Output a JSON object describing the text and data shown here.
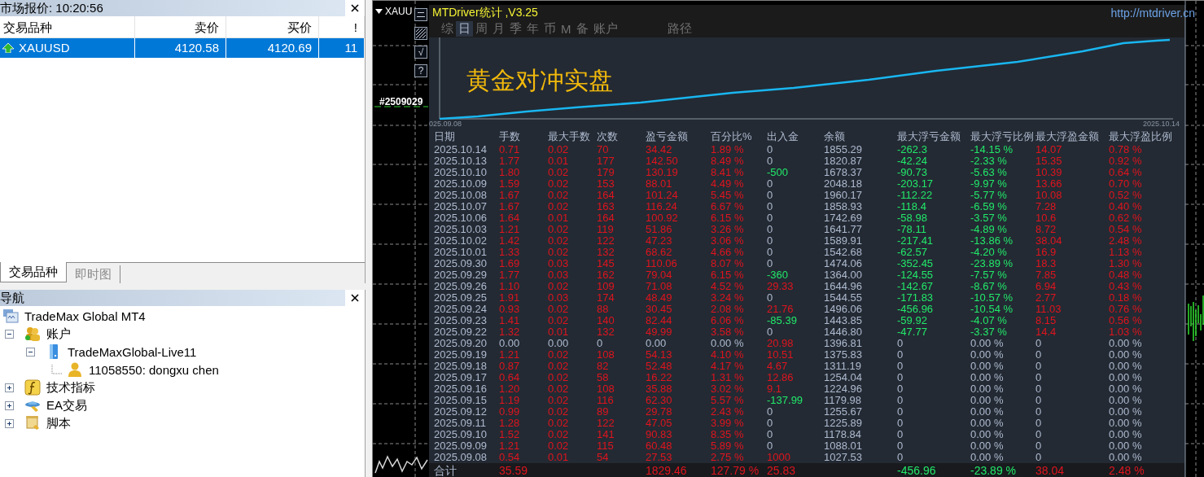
{
  "market_watch": {
    "title": "市场报价: 10:20:56",
    "columns": [
      "交易品种",
      "卖价",
      "买价",
      "!"
    ],
    "rows": [
      {
        "symbol": "XAUUSD",
        "bid": "4120.58",
        "ask": "4120.69",
        "spread": "11",
        "selected": true
      }
    ],
    "tabs": [
      {
        "label": "交易品种",
        "selected": true
      },
      {
        "label": "即时图",
        "selected": false
      }
    ]
  },
  "navigator": {
    "title": "导航",
    "tree": [
      {
        "label": "TradeMax Global MT4",
        "kind": "terminal",
        "children": [
          {
            "label": "账户",
            "kind": "accounts",
            "expanded": true,
            "children": [
              {
                "label": "TradeMaxGlobal-Live11",
                "kind": "server",
                "expanded": true,
                "children": [
                  {
                    "label": "11058550: dongxu chen",
                    "kind": "user"
                  }
                ]
              }
            ]
          },
          {
            "label": "技术指标",
            "kind": "indicators",
            "expanded": false
          },
          {
            "label": "EA交易",
            "kind": "experts",
            "expanded": false
          },
          {
            "label": "脚本",
            "kind": "scripts",
            "expanded": false
          }
        ]
      }
    ]
  },
  "chart": {
    "symbol": "XAUU",
    "order_label": "#2509029",
    "tool_buttons": [
      {
        "kind": "lines"
      },
      {
        "kind": "hatch"
      },
      {
        "kind": "text",
        "label": "√"
      },
      {
        "kind": "text",
        "label": "?"
      }
    ]
  },
  "stats_panel": {
    "title": "MTDriver统计 ,V3.25",
    "url": "http://mtdriver.cn",
    "tabs": [
      {
        "label": "综",
        "selected": false
      },
      {
        "label": "日",
        "selected": true
      },
      {
        "label": "周",
        "selected": false
      },
      {
        "label": "月",
        "selected": false
      },
      {
        "label": "季",
        "selected": false
      },
      {
        "label": "年",
        "selected": false
      },
      {
        "label": "币",
        "selected": false
      },
      {
        "label": "M",
        "selected": false
      },
      {
        "label": "备",
        "selected": false
      },
      {
        "label": "账户",
        "selected": false
      }
    ],
    "path_tab": {
      "label": "路径",
      "selected": false
    },
    "equity_title": "黄金对冲实盘",
    "start_date": "025.09.08",
    "end_date": "2025.10.14",
    "columns": [
      "日期",
      "手数",
      "最大手数",
      "次数",
      "盈亏金额",
      "百分比%",
      "出入金",
      "余额",
      "最大浮亏金额",
      "最大浮亏比例",
      "最大浮盈金额",
      "最大浮盈比例"
    ],
    "rows": [
      {
        "cells": [
          {
            "text": "2025.10.14",
            "color": "#aebad0"
          },
          {
            "text": "0.71",
            "color": "#e0141e"
          },
          {
            "text": "0.02",
            "color": "#e0141e"
          },
          {
            "text": "70",
            "color": "#e0141e"
          },
          {
            "text": "34.42",
            "color": "#e0141e"
          },
          {
            "text": "1.89 %",
            "color": "#e0141e"
          },
          {
            "text": "0",
            "color": "#aebad0"
          },
          {
            "text": "1855.29",
            "color": "#aebad0"
          },
          {
            "text": "-262.3",
            "color": "#22e86a"
          },
          {
            "text": "-14.15 %",
            "color": "#22e86a"
          },
          {
            "text": "14.07",
            "color": "#e0141e"
          },
          {
            "text": "0.78 %",
            "color": "#e0141e"
          }
        ]
      },
      {
        "cells": [
          {
            "text": "2025.10.13",
            "color": "#aebad0"
          },
          {
            "text": "1.77",
            "color": "#e0141e"
          },
          {
            "text": "0.01",
            "color": "#e0141e"
          },
          {
            "text": "177",
            "color": "#e0141e"
          },
          {
            "text": "142.50",
            "color": "#e0141e"
          },
          {
            "text": "8.49 %",
            "color": "#e0141e"
          },
          {
            "text": "0",
            "color": "#aebad0"
          },
          {
            "text": "1820.87",
            "color": "#aebad0"
          },
          {
            "text": "-42.24",
            "color": "#22e86a"
          },
          {
            "text": "-2.33 %",
            "color": "#22e86a"
          },
          {
            "text": "15.35",
            "color": "#e0141e"
          },
          {
            "text": "0.92 %",
            "color": "#e0141e"
          }
        ]
      },
      {
        "cells": [
          {
            "text": "2025.10.10",
            "color": "#aebad0"
          },
          {
            "text": "1.80",
            "color": "#e0141e"
          },
          {
            "text": "0.02",
            "color": "#e0141e"
          },
          {
            "text": "179",
            "color": "#e0141e"
          },
          {
            "text": "130.19",
            "color": "#e0141e"
          },
          {
            "text": "8.41 %",
            "color": "#e0141e"
          },
          {
            "text": "-500",
            "color": "#22e86a"
          },
          {
            "text": "1678.37",
            "color": "#aebad0"
          },
          {
            "text": "-90.73",
            "color": "#22e86a"
          },
          {
            "text": "-5.63 %",
            "color": "#22e86a"
          },
          {
            "text": "10.39",
            "color": "#e0141e"
          },
          {
            "text": "0.64 %",
            "color": "#e0141e"
          }
        ]
      },
      {
        "cells": [
          {
            "text": "2025.10.09",
            "color": "#aebad0"
          },
          {
            "text": "1.59",
            "color": "#e0141e"
          },
          {
            "text": "0.02",
            "color": "#e0141e"
          },
          {
            "text": "153",
            "color": "#e0141e"
          },
          {
            "text": "88.01",
            "color": "#e0141e"
          },
          {
            "text": "4.49 %",
            "color": "#e0141e"
          },
          {
            "text": "0",
            "color": "#aebad0"
          },
          {
            "text": "2048.18",
            "color": "#aebad0"
          },
          {
            "text": "-203.17",
            "color": "#22e86a"
          },
          {
            "text": "-9.97 %",
            "color": "#22e86a"
          },
          {
            "text": "13.66",
            "color": "#e0141e"
          },
          {
            "text": "0.70 %",
            "color": "#e0141e"
          }
        ]
      },
      {
        "cells": [
          {
            "text": "2025.10.08",
            "color": "#aebad0"
          },
          {
            "text": "1.67",
            "color": "#e0141e"
          },
          {
            "text": "0.02",
            "color": "#e0141e"
          },
          {
            "text": "164",
            "color": "#e0141e"
          },
          {
            "text": "101.24",
            "color": "#e0141e"
          },
          {
            "text": "5.45 %",
            "color": "#e0141e"
          },
          {
            "text": "0",
            "color": "#aebad0"
          },
          {
            "text": "1960.17",
            "color": "#aebad0"
          },
          {
            "text": "-112.22",
            "color": "#22e86a"
          },
          {
            "text": "-5.77 %",
            "color": "#22e86a"
          },
          {
            "text": "10.08",
            "color": "#e0141e"
          },
          {
            "text": "0.52 %",
            "color": "#e0141e"
          }
        ]
      },
      {
        "cells": [
          {
            "text": "2025.10.07",
            "color": "#aebad0"
          },
          {
            "text": "1.67",
            "color": "#e0141e"
          },
          {
            "text": "0.02",
            "color": "#e0141e"
          },
          {
            "text": "163",
            "color": "#e0141e"
          },
          {
            "text": "116.24",
            "color": "#e0141e"
          },
          {
            "text": "6.67 %",
            "color": "#e0141e"
          },
          {
            "text": "0",
            "color": "#aebad0"
          },
          {
            "text": "1858.93",
            "color": "#aebad0"
          },
          {
            "text": "-118.4",
            "color": "#22e86a"
          },
          {
            "text": "-6.59 %",
            "color": "#22e86a"
          },
          {
            "text": "7.28",
            "color": "#e0141e"
          },
          {
            "text": "0.40 %",
            "color": "#e0141e"
          }
        ]
      },
      {
        "cells": [
          {
            "text": "2025.10.06",
            "color": "#aebad0"
          },
          {
            "text": "1.64",
            "color": "#e0141e"
          },
          {
            "text": "0.01",
            "color": "#e0141e"
          },
          {
            "text": "164",
            "color": "#e0141e"
          },
          {
            "text": "100.92",
            "color": "#e0141e"
          },
          {
            "text": "6.15 %",
            "color": "#e0141e"
          },
          {
            "text": "0",
            "color": "#aebad0"
          },
          {
            "text": "1742.69",
            "color": "#aebad0"
          },
          {
            "text": "-58.98",
            "color": "#22e86a"
          },
          {
            "text": "-3.57 %",
            "color": "#22e86a"
          },
          {
            "text": "10.6",
            "color": "#e0141e"
          },
          {
            "text": "0.62 %",
            "color": "#e0141e"
          }
        ]
      },
      {
        "cells": [
          {
            "text": "2025.10.03",
            "color": "#aebad0"
          },
          {
            "text": "1.21",
            "color": "#e0141e"
          },
          {
            "text": "0.02",
            "color": "#e0141e"
          },
          {
            "text": "119",
            "color": "#e0141e"
          },
          {
            "text": "51.86",
            "color": "#e0141e"
          },
          {
            "text": "3.26 %",
            "color": "#e0141e"
          },
          {
            "text": "0",
            "color": "#aebad0"
          },
          {
            "text": "1641.77",
            "color": "#aebad0"
          },
          {
            "text": "-78.11",
            "color": "#22e86a"
          },
          {
            "text": "-4.89 %",
            "color": "#22e86a"
          },
          {
            "text": "8.72",
            "color": "#e0141e"
          },
          {
            "text": "0.54 %",
            "color": "#e0141e"
          }
        ]
      },
      {
        "cells": [
          {
            "text": "2025.10.02",
            "color": "#aebad0"
          },
          {
            "text": "1.42",
            "color": "#e0141e"
          },
          {
            "text": "0.02",
            "color": "#e0141e"
          },
          {
            "text": "122",
            "color": "#e0141e"
          },
          {
            "text": "47.23",
            "color": "#e0141e"
          },
          {
            "text": "3.06 %",
            "color": "#e0141e"
          },
          {
            "text": "0",
            "color": "#aebad0"
          },
          {
            "text": "1589.91",
            "color": "#aebad0"
          },
          {
            "text": "-217.41",
            "color": "#22e86a"
          },
          {
            "text": "-13.86 %",
            "color": "#22e86a"
          },
          {
            "text": "38.04",
            "color": "#e0141e"
          },
          {
            "text": "2.48 %",
            "color": "#e0141e"
          }
        ]
      },
      {
        "cells": [
          {
            "text": "2025.10.01",
            "color": "#aebad0"
          },
          {
            "text": "1.33",
            "color": "#e0141e"
          },
          {
            "text": "0.02",
            "color": "#e0141e"
          },
          {
            "text": "132",
            "color": "#e0141e"
          },
          {
            "text": "68.62",
            "color": "#e0141e"
          },
          {
            "text": "4.66 %",
            "color": "#e0141e"
          },
          {
            "text": "0",
            "color": "#aebad0"
          },
          {
            "text": "1542.68",
            "color": "#aebad0"
          },
          {
            "text": "-62.57",
            "color": "#22e86a"
          },
          {
            "text": "-4.20 %",
            "color": "#22e86a"
          },
          {
            "text": "16.9",
            "color": "#e0141e"
          },
          {
            "text": "1.13 %",
            "color": "#e0141e"
          }
        ]
      },
      {
        "cells": [
          {
            "text": "2025.09.30",
            "color": "#aebad0"
          },
          {
            "text": "1.69",
            "color": "#e0141e"
          },
          {
            "text": "0.03",
            "color": "#e0141e"
          },
          {
            "text": "145",
            "color": "#e0141e"
          },
          {
            "text": "110.06",
            "color": "#e0141e"
          },
          {
            "text": "8.07 %",
            "color": "#e0141e"
          },
          {
            "text": "0",
            "color": "#aebad0"
          },
          {
            "text": "1474.06",
            "color": "#aebad0"
          },
          {
            "text": "-352.45",
            "color": "#22e86a"
          },
          {
            "text": "-23.89 %",
            "color": "#22e86a"
          },
          {
            "text": "18.3",
            "color": "#e0141e"
          },
          {
            "text": "1.30 %",
            "color": "#e0141e"
          }
        ]
      },
      {
        "cells": [
          {
            "text": "2025.09.29",
            "color": "#aebad0"
          },
          {
            "text": "1.77",
            "color": "#e0141e"
          },
          {
            "text": "0.03",
            "color": "#e0141e"
          },
          {
            "text": "162",
            "color": "#e0141e"
          },
          {
            "text": "79.04",
            "color": "#e0141e"
          },
          {
            "text": "6.15 %",
            "color": "#e0141e"
          },
          {
            "text": "-360",
            "color": "#22e86a"
          },
          {
            "text": "1364.00",
            "color": "#aebad0"
          },
          {
            "text": "-124.55",
            "color": "#22e86a"
          },
          {
            "text": "-7.57 %",
            "color": "#22e86a"
          },
          {
            "text": "7.85",
            "color": "#e0141e"
          },
          {
            "text": "0.48 %",
            "color": "#e0141e"
          }
        ]
      },
      {
        "cells": [
          {
            "text": "2025.09.26",
            "color": "#aebad0"
          },
          {
            "text": "1.10",
            "color": "#e0141e"
          },
          {
            "text": "0.02",
            "color": "#e0141e"
          },
          {
            "text": "109",
            "color": "#e0141e"
          },
          {
            "text": "71.08",
            "color": "#e0141e"
          },
          {
            "text": "4.52 %",
            "color": "#e0141e"
          },
          {
            "text": "29.33",
            "color": "#e0141e"
          },
          {
            "text": "1644.96",
            "color": "#aebad0"
          },
          {
            "text": "-142.67",
            "color": "#22e86a"
          },
          {
            "text": "-8.67 %",
            "color": "#22e86a"
          },
          {
            "text": "6.94",
            "color": "#e0141e"
          },
          {
            "text": "0.43 %",
            "color": "#e0141e"
          }
        ]
      },
      {
        "cells": [
          {
            "text": "2025.09.25",
            "color": "#aebad0"
          },
          {
            "text": "1.91",
            "color": "#e0141e"
          },
          {
            "text": "0.03",
            "color": "#e0141e"
          },
          {
            "text": "174",
            "color": "#e0141e"
          },
          {
            "text": "48.49",
            "color": "#e0141e"
          },
          {
            "text": "3.24 %",
            "color": "#e0141e"
          },
          {
            "text": "0",
            "color": "#aebad0"
          },
          {
            "text": "1544.55",
            "color": "#aebad0"
          },
          {
            "text": "-171.83",
            "color": "#22e86a"
          },
          {
            "text": "-10.57 %",
            "color": "#22e86a"
          },
          {
            "text": "2.77",
            "color": "#e0141e"
          },
          {
            "text": "0.18 %",
            "color": "#e0141e"
          }
        ]
      },
      {
        "cells": [
          {
            "text": "2025.09.24",
            "color": "#aebad0"
          },
          {
            "text": "0.93",
            "color": "#e0141e"
          },
          {
            "text": "0.02",
            "color": "#e0141e"
          },
          {
            "text": "88",
            "color": "#e0141e"
          },
          {
            "text": "30.45",
            "color": "#e0141e"
          },
          {
            "text": "2.08 %",
            "color": "#e0141e"
          },
          {
            "text": "21.76",
            "color": "#e0141e"
          },
          {
            "text": "1496.06",
            "color": "#aebad0"
          },
          {
            "text": "-456.96",
            "color": "#22e86a"
          },
          {
            "text": "-10.54 %",
            "color": "#22e86a"
          },
          {
            "text": "11.03",
            "color": "#e0141e"
          },
          {
            "text": "0.76 %",
            "color": "#e0141e"
          }
        ]
      },
      {
        "cells": [
          {
            "text": "2025.09.23",
            "color": "#aebad0"
          },
          {
            "text": "1.41",
            "color": "#e0141e"
          },
          {
            "text": "0.02",
            "color": "#e0141e"
          },
          {
            "text": "140",
            "color": "#e0141e"
          },
          {
            "text": "82.44",
            "color": "#e0141e"
          },
          {
            "text": "6.06 %",
            "color": "#e0141e"
          },
          {
            "text": "-85.39",
            "color": "#22e86a"
          },
          {
            "text": "1443.85",
            "color": "#aebad0"
          },
          {
            "text": "-59.92",
            "color": "#22e86a"
          },
          {
            "text": "-4.07 %",
            "color": "#22e86a"
          },
          {
            "text": "8.15",
            "color": "#e0141e"
          },
          {
            "text": "0.56 %",
            "color": "#e0141e"
          }
        ]
      },
      {
        "cells": [
          {
            "text": "2025.09.22",
            "color": "#aebad0"
          },
          {
            "text": "1.32",
            "color": "#e0141e"
          },
          {
            "text": "0.01",
            "color": "#e0141e"
          },
          {
            "text": "132",
            "color": "#e0141e"
          },
          {
            "text": "49.99",
            "color": "#e0141e"
          },
          {
            "text": "3.58 %",
            "color": "#e0141e"
          },
          {
            "text": "0",
            "color": "#aebad0"
          },
          {
            "text": "1446.80",
            "color": "#aebad0"
          },
          {
            "text": "-47.77",
            "color": "#22e86a"
          },
          {
            "text": "-3.37 %",
            "color": "#22e86a"
          },
          {
            "text": "14.4",
            "color": "#e0141e"
          },
          {
            "text": "1.03 %",
            "color": "#e0141e"
          }
        ]
      },
      {
        "cells": [
          {
            "text": "2025.09.20",
            "color": "#aebad0"
          },
          {
            "text": "0.00",
            "color": "#aebad0"
          },
          {
            "text": "0.00",
            "color": "#aebad0"
          },
          {
            "text": "0",
            "color": "#aebad0"
          },
          {
            "text": "0.00",
            "color": "#aebad0"
          },
          {
            "text": "0.00 %",
            "color": "#aebad0"
          },
          {
            "text": "20.98",
            "color": "#e0141e"
          },
          {
            "text": "1396.81",
            "color": "#aebad0"
          },
          {
            "text": "0",
            "color": "#aebad0"
          },
          {
            "text": "0.00 %",
            "color": "#aebad0"
          },
          {
            "text": "0",
            "color": "#aebad0"
          },
          {
            "text": "0.00 %",
            "color": "#aebad0"
          }
        ]
      },
      {
        "cells": [
          {
            "text": "2025.09.19",
            "color": "#aebad0"
          },
          {
            "text": "1.21",
            "color": "#e0141e"
          },
          {
            "text": "0.02",
            "color": "#e0141e"
          },
          {
            "text": "108",
            "color": "#e0141e"
          },
          {
            "text": "54.13",
            "color": "#e0141e"
          },
          {
            "text": "4.10 %",
            "color": "#e0141e"
          },
          {
            "text": "10.51",
            "color": "#e0141e"
          },
          {
            "text": "1375.83",
            "color": "#aebad0"
          },
          {
            "text": "0",
            "color": "#aebad0"
          },
          {
            "text": "0.00 %",
            "color": "#aebad0"
          },
          {
            "text": "0",
            "color": "#aebad0"
          },
          {
            "text": "0.00 %",
            "color": "#aebad0"
          }
        ]
      },
      {
        "cells": [
          {
            "text": "2025.09.18",
            "color": "#aebad0"
          },
          {
            "text": "0.87",
            "color": "#e0141e"
          },
          {
            "text": "0.02",
            "color": "#e0141e"
          },
          {
            "text": "82",
            "color": "#e0141e"
          },
          {
            "text": "52.48",
            "color": "#e0141e"
          },
          {
            "text": "4.17 %",
            "color": "#e0141e"
          },
          {
            "text": "4.67",
            "color": "#e0141e"
          },
          {
            "text": "1311.19",
            "color": "#aebad0"
          },
          {
            "text": "0",
            "color": "#aebad0"
          },
          {
            "text": "0.00 %",
            "color": "#aebad0"
          },
          {
            "text": "0",
            "color": "#aebad0"
          },
          {
            "text": "0.00 %",
            "color": "#aebad0"
          }
        ]
      },
      {
        "cells": [
          {
            "text": "2025.09.17",
            "color": "#aebad0"
          },
          {
            "text": "0.64",
            "color": "#e0141e"
          },
          {
            "text": "0.02",
            "color": "#e0141e"
          },
          {
            "text": "58",
            "color": "#e0141e"
          },
          {
            "text": "16.22",
            "color": "#e0141e"
          },
          {
            "text": "1.31 %",
            "color": "#e0141e"
          },
          {
            "text": "12.86",
            "color": "#e0141e"
          },
          {
            "text": "1254.04",
            "color": "#aebad0"
          },
          {
            "text": "0",
            "color": "#aebad0"
          },
          {
            "text": "0.00 %",
            "color": "#aebad0"
          },
          {
            "text": "0",
            "color": "#aebad0"
          },
          {
            "text": "0.00 %",
            "color": "#aebad0"
          }
        ]
      },
      {
        "cells": [
          {
            "text": "2025.09.16",
            "color": "#aebad0"
          },
          {
            "text": "1.20",
            "color": "#e0141e"
          },
          {
            "text": "0.02",
            "color": "#e0141e"
          },
          {
            "text": "108",
            "color": "#e0141e"
          },
          {
            "text": "35.88",
            "color": "#e0141e"
          },
          {
            "text": "3.02 %",
            "color": "#e0141e"
          },
          {
            "text": "9.1",
            "color": "#e0141e"
          },
          {
            "text": "1224.96",
            "color": "#aebad0"
          },
          {
            "text": "0",
            "color": "#aebad0"
          },
          {
            "text": "0.00 %",
            "color": "#aebad0"
          },
          {
            "text": "0",
            "color": "#aebad0"
          },
          {
            "text": "0.00 %",
            "color": "#aebad0"
          }
        ]
      },
      {
        "cells": [
          {
            "text": "2025.09.15",
            "color": "#aebad0"
          },
          {
            "text": "1.19",
            "color": "#e0141e"
          },
          {
            "text": "0.02",
            "color": "#e0141e"
          },
          {
            "text": "116",
            "color": "#e0141e"
          },
          {
            "text": "62.30",
            "color": "#e0141e"
          },
          {
            "text": "5.57 %",
            "color": "#e0141e"
          },
          {
            "text": "-137.99",
            "color": "#22e86a"
          },
          {
            "text": "1179.98",
            "color": "#aebad0"
          },
          {
            "text": "0",
            "color": "#aebad0"
          },
          {
            "text": "0.00 %",
            "color": "#aebad0"
          },
          {
            "text": "0",
            "color": "#aebad0"
          },
          {
            "text": "0.00 %",
            "color": "#aebad0"
          }
        ]
      },
      {
        "cells": [
          {
            "text": "2025.09.12",
            "color": "#aebad0"
          },
          {
            "text": "0.99",
            "color": "#e0141e"
          },
          {
            "text": "0.02",
            "color": "#e0141e"
          },
          {
            "text": "89",
            "color": "#e0141e"
          },
          {
            "text": "29.78",
            "color": "#e0141e"
          },
          {
            "text": "2.43 %",
            "color": "#e0141e"
          },
          {
            "text": "0",
            "color": "#aebad0"
          },
          {
            "text": "1255.67",
            "color": "#aebad0"
          },
          {
            "text": "0",
            "color": "#aebad0"
          },
          {
            "text": "0.00 %",
            "color": "#aebad0"
          },
          {
            "text": "0",
            "color": "#aebad0"
          },
          {
            "text": "0.00 %",
            "color": "#aebad0"
          }
        ]
      },
      {
        "cells": [
          {
            "text": "2025.09.11",
            "color": "#aebad0"
          },
          {
            "text": "1.28",
            "color": "#e0141e"
          },
          {
            "text": "0.02",
            "color": "#e0141e"
          },
          {
            "text": "122",
            "color": "#e0141e"
          },
          {
            "text": "47.05",
            "color": "#e0141e"
          },
          {
            "text": "3.99 %",
            "color": "#e0141e"
          },
          {
            "text": "0",
            "color": "#aebad0"
          },
          {
            "text": "1225.89",
            "color": "#aebad0"
          },
          {
            "text": "0",
            "color": "#aebad0"
          },
          {
            "text": "0.00 %",
            "color": "#aebad0"
          },
          {
            "text": "0",
            "color": "#aebad0"
          },
          {
            "text": "0.00 %",
            "color": "#aebad0"
          }
        ]
      },
      {
        "cells": [
          {
            "text": "2025.09.10",
            "color": "#aebad0"
          },
          {
            "text": "1.52",
            "color": "#e0141e"
          },
          {
            "text": "0.02",
            "color": "#e0141e"
          },
          {
            "text": "141",
            "color": "#e0141e"
          },
          {
            "text": "90.83",
            "color": "#e0141e"
          },
          {
            "text": "8.35 %",
            "color": "#e0141e"
          },
          {
            "text": "0",
            "color": "#aebad0"
          },
          {
            "text": "1178.84",
            "color": "#aebad0"
          },
          {
            "text": "0",
            "color": "#aebad0"
          },
          {
            "text": "0.00 %",
            "color": "#aebad0"
          },
          {
            "text": "0",
            "color": "#aebad0"
          },
          {
            "text": "0.00 %",
            "color": "#aebad0"
          }
        ]
      },
      {
        "cells": [
          {
            "text": "2025.09.09",
            "color": "#aebad0"
          },
          {
            "text": "1.21",
            "color": "#e0141e"
          },
          {
            "text": "0.02",
            "color": "#e0141e"
          },
          {
            "text": "115",
            "color": "#e0141e"
          },
          {
            "text": "60.48",
            "color": "#e0141e"
          },
          {
            "text": "5.89 %",
            "color": "#e0141e"
          },
          {
            "text": "0",
            "color": "#aebad0"
          },
          {
            "text": "1088.01",
            "color": "#aebad0"
          },
          {
            "text": "0",
            "color": "#aebad0"
          },
          {
            "text": "0.00 %",
            "color": "#aebad0"
          },
          {
            "text": "0",
            "color": "#aebad0"
          },
          {
            "text": "0.00 %",
            "color": "#aebad0"
          }
        ]
      },
      {
        "cells": [
          {
            "text": "2025.09.08",
            "color": "#aebad0"
          },
          {
            "text": "0.54",
            "color": "#e0141e"
          },
          {
            "text": "0.01",
            "color": "#e0141e"
          },
          {
            "text": "54",
            "color": "#e0141e"
          },
          {
            "text": "27.53",
            "color": "#e0141e"
          },
          {
            "text": "2.75 %",
            "color": "#e0141e"
          },
          {
            "text": "1000",
            "color": "#e0141e"
          },
          {
            "text": "1027.53",
            "color": "#aebad0"
          },
          {
            "text": "0",
            "color": "#aebad0"
          },
          {
            "text": "0.00 %",
            "color": "#aebad0"
          },
          {
            "text": "0",
            "color": "#aebad0"
          },
          {
            "text": "0.00 %",
            "color": "#aebad0"
          }
        ]
      }
    ],
    "totals": {
      "cells": [
        {
          "text": "合计",
          "color": "#aebad0"
        },
        {
          "text": "35.59",
          "color": "#e0141e"
        },
        {
          "text": ""
        },
        {
          "text": ""
        },
        {
          "text": "1829.46",
          "color": "#e0141e"
        },
        {
          "text": "127.79 %",
          "color": "#e0141e"
        },
        {
          "text": "25.83",
          "color": "#e0141e"
        },
        {
          "text": ""
        },
        {
          "text": "-456.96",
          "color": "#22e86a"
        },
        {
          "text": "-23.89 %",
          "color": "#22e86a"
        },
        {
          "text": "38.04",
          "color": "#e0141e"
        },
        {
          "text": "2.48 %",
          "color": "#e0141e"
        }
      ]
    }
  }
}
